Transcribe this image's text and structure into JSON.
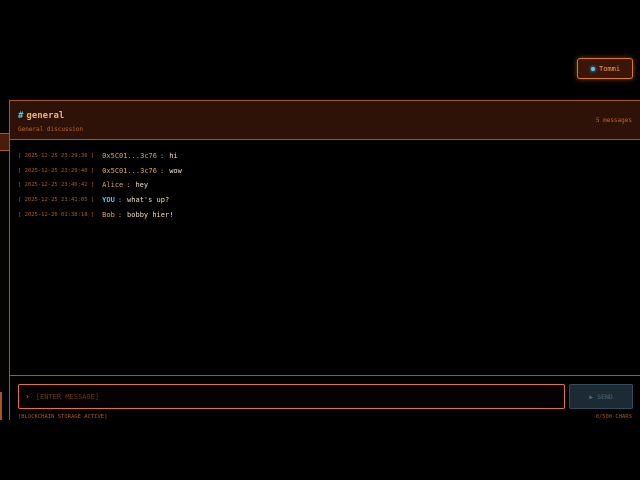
{
  "user": {
    "name": "Tommi"
  },
  "channel": {
    "name": "general",
    "description": "General discussion",
    "message_count": "5 messages"
  },
  "messages": [
    {
      "timestamp": "[ 2025-12-25 23:29:36 ]",
      "sender": "0x5C01...3c76",
      "separator": ":",
      "text": "hi"
    },
    {
      "timestamp": "[ 2025-12-25 23:29:40 ]",
      "sender": "0x5C01...3c76",
      "separator": ":",
      "text": "wow"
    },
    {
      "timestamp": "[ 2025-12-25 23:40:42 ]",
      "sender": "Alice",
      "separator": ":",
      "text": "hey"
    },
    {
      "timestamp": "[ 2025-12-25 23:41:05 ]",
      "sender": "YOU",
      "separator": ":",
      "text": "what's up?"
    },
    {
      "timestamp": "[ 2025-12-26 01:38:18 ]",
      "sender": "Bob",
      "separator": ":",
      "text": "bobby hier!"
    }
  ],
  "composer": {
    "prompt": "›",
    "placeholder": "[ENTER MESSAGE]",
    "send_icon": "▶",
    "send_label": "SEND",
    "storage_status": "[BLOCKCHAIN STORAGE ACTIVE]",
    "char_count": "0/500 CHARS"
  },
  "colors": {
    "accent": "#e07a1e",
    "highlight": "#3fd0ff",
    "background": "#000000",
    "header_bg": "#2e1208"
  }
}
